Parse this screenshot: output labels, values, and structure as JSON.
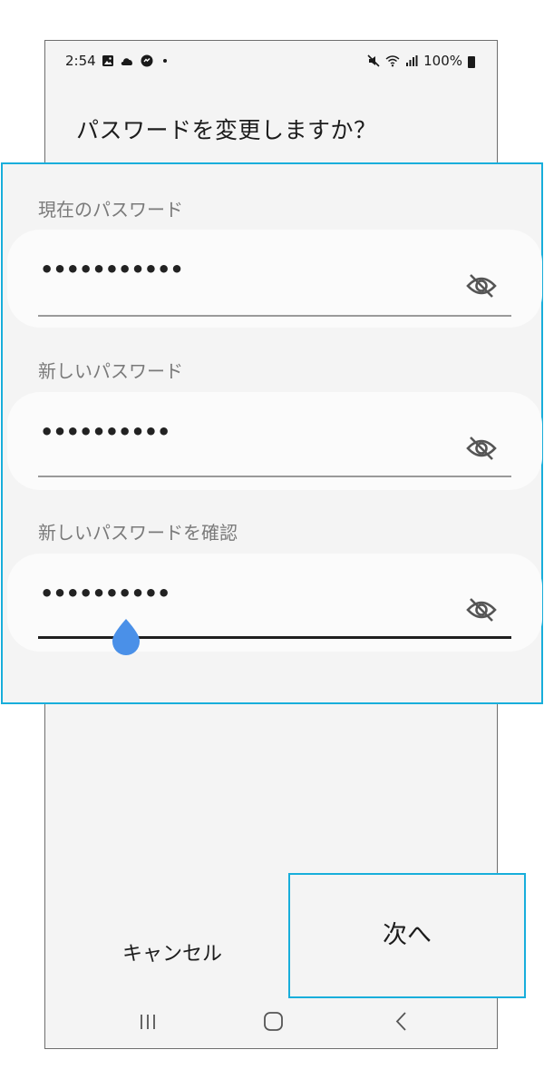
{
  "status_bar": {
    "time": "2:54",
    "battery": "100%",
    "icons_left": [
      "gallery-icon",
      "cloud-icon",
      "messenger-icon",
      "dot-icon"
    ],
    "icons_right": [
      "mute-icon",
      "wifi-icon",
      "signal-icon",
      "battery-icon"
    ]
  },
  "dialog": {
    "title": "パスワードを変更しますか？",
    "fields": [
      {
        "label": "現在のパスワード",
        "value": "•••••••••••"
      },
      {
        "label": "新しいパスワード",
        "value": "••••••••••"
      },
      {
        "label": "新しいパスワードを確認",
        "value": "••••••••••"
      }
    ],
    "cancel_label": "キャンセル",
    "next_label": "次へ"
  },
  "colors": {
    "highlight": "#18aedb",
    "cursor": "#4a90e8",
    "background": "#f4f4f4"
  }
}
